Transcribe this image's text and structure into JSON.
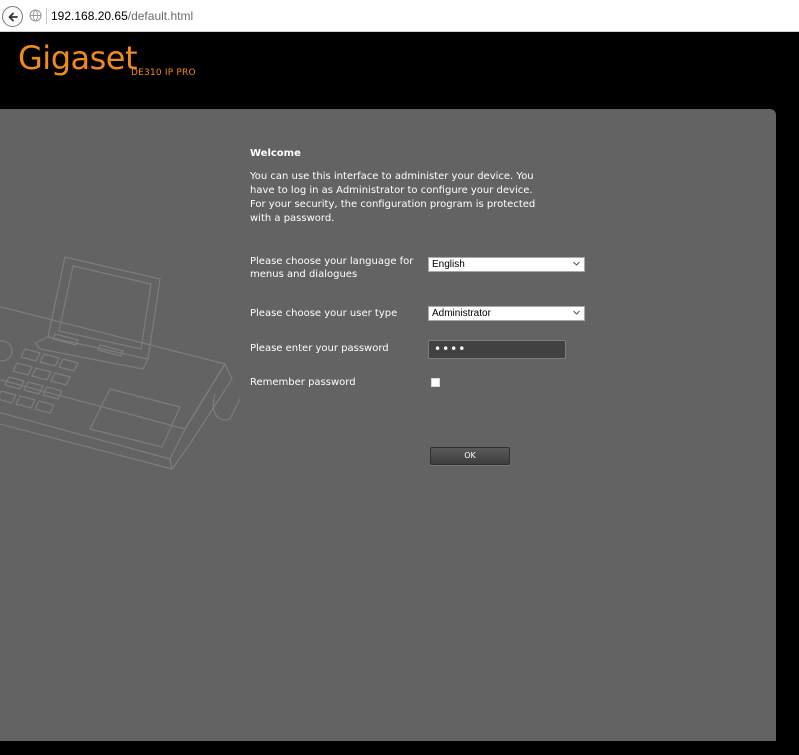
{
  "browser": {
    "url_host": "192.168.20.65",
    "url_path": "/default.html"
  },
  "header": {
    "logo": "Gigaset",
    "model": "DE310 IP PRO",
    "brand_color": "#f08a1c"
  },
  "welcome": {
    "title": "Welcome",
    "text": "You can use this interface to administer your device. You have to log in as Administrator to configure your device. For your security, the configuration program is protected with a password."
  },
  "form": {
    "language_label": "Please choose your language for menus and dialogues",
    "language_value": "English",
    "user_type_label": "Please choose your user type",
    "user_type_value": "Administrator",
    "password_label": "Please enter your password",
    "password_value": "••••",
    "remember_label": "Remember password",
    "remember_checked": false,
    "ok_label": "OK"
  },
  "colors": {
    "panel_bg": "#636363",
    "page_bg": "#000000"
  }
}
